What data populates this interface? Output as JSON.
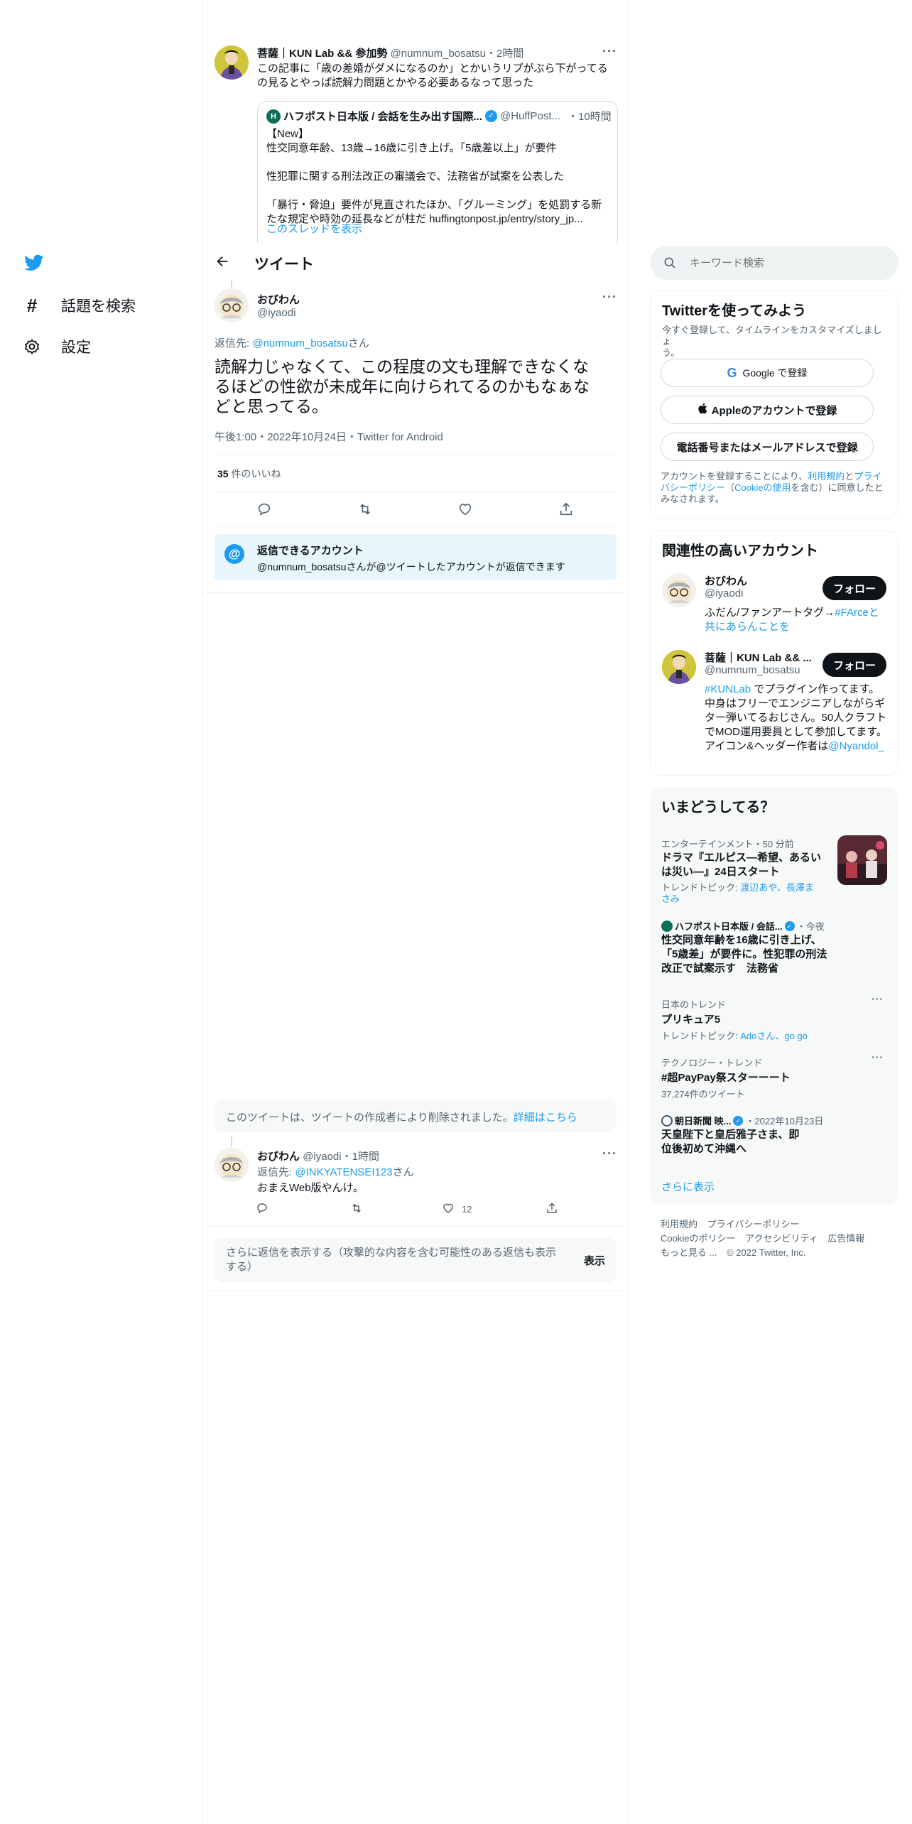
{
  "nav": {
    "explore_label": "話題を検索",
    "settings_label": "設定"
  },
  "header": {
    "title": "ツイート"
  },
  "parent_tweet": {
    "display_name": "菩薩｜KUN Lab && 参加勢",
    "handle": "@numnum_bosatsu",
    "time": "・2時間",
    "text_line1": "この記事に「歳の差婚がダメになるのか」とかいうリプがぶら下がってる",
    "text_line2": "の見るとやっぱ読解力問題とかやる必要あるなって思った",
    "quote": {
      "name": "ハフポスト日本版 / 会話を生み出す国際...",
      "handle": "@HuffPost...",
      "time": "・10時間",
      "line1": "【New】",
      "line2": "性交同意年齢、13歳→16歳に引き上げ。「5歳差以上」が要件",
      "line3": "性犯罪に関する刑法改正の審議会で、法務省が試案を公表した",
      "line4": "「暴行・脅迫」要件が見直されたほか、「グルーミング」を処罰する新",
      "line5": "たな規定や時効の延長などが柱だ huffingtonpost.jp/entry/story_jp..."
    },
    "show_thread": "このスレッドを表示"
  },
  "main_tweet": {
    "display_name": "おびわん",
    "handle": "@iyaodi",
    "reply_prefix": "返信先: ",
    "reply_to": "@numnum_bosatsu",
    "reply_suffix": "さん",
    "text_line1": "読解力じゃなくて、この程度の文も理解できなくな",
    "text_line2": "るほどの性欲が未成年に向けられてるのかもなぁな",
    "text_line3": "どと思ってる。",
    "meta": "午後1:00・2022年10月24日・Twitter for Android",
    "likes_count": "35",
    "likes_label": "件のいいね"
  },
  "reply_restriction": {
    "title": "返信できるアカウント",
    "text": "@numnum_bosatsuさんが@ツイートしたアカウントが返信できます"
  },
  "deleted_notice": {
    "text": "このツイートは、ツイートの作成者により削除されました。",
    "link": "詳細はこちら"
  },
  "reply_tweet": {
    "display_name": "おびわん",
    "handle": "@iyaodi",
    "time": "・1時間",
    "reply_prefix": "返信先: ",
    "reply_to": "@INKYATENSEI123",
    "reply_suffix": "さん",
    "text": "おまえWeb版やんけ。",
    "likes": "12"
  },
  "more_replies": {
    "text_line1": "さらに返信を表示する（攻撃的な内容を含む可能性のある返信も表示",
    "text_line2": "する）",
    "button": "表示"
  },
  "search": {
    "placeholder": "キーワード検索"
  },
  "signup": {
    "title": "Twitterを使ってみよう",
    "subtitle_line1": "今すぐ登録して、タイムラインをカスタマイズしましょ",
    "subtitle_line2": "う。",
    "google_button": "Google で登録",
    "apple_button": "Appleのアカウントで登録",
    "phone_button": "電話番号またはメールアドレスで登録",
    "legal_a": "アカウントを登録することにより、",
    "legal_terms": "利用規約",
    "legal_b": "と",
    "legal_privacy": "プライバシーポリシー",
    "legal_c": "（",
    "legal_cookie": "Cookieの使用",
    "legal_d": "を含む）に同意したとみなされます。"
  },
  "related": {
    "title": "関連性の高いアカウント",
    "follow_label": "フォロー",
    "accounts": [
      {
        "name": "おびわん",
        "handle": "@iyaodi",
        "bio_a": "ふだん/ファンアートタグ→",
        "bio_link": "#FArceと共にあらんことを"
      },
      {
        "name": "菩薩｜KUN Lab && ...",
        "handle": "@numnum_bosatsu",
        "bio_link1": "#KUNLab",
        "bio_b": " でプラグイン作ってます。中身はフリーでエンジニアしながらギター弾いてるおじさん。50人クラフトでMOD運用要員として参加してます。アイコン&ヘッダー作者は",
        "bio_link2": "@Nyandol_"
      }
    ]
  },
  "trends": {
    "title": "いまどうしてる？",
    "items": [
      {
        "meta": "エンターテインメント・50 分前",
        "title": "ドラマ『エルピス―希望、あるいは災い―』24日スタート",
        "topic_prefix": "トレンドトピック: ",
        "topic": "渡辺あや、長澤まさみ"
      },
      {
        "source": "ハフポスト日本版 / 会話...",
        "time": "・今夜",
        "title": "性交同意年齢を16歳に引き上げ、「5歳差」が要件に。性犯罪の刑法改正で試案示す　法務省"
      },
      {
        "meta": "日本のトレンド",
        "title": "プリキュア5",
        "topic_prefix": "トレンドトピック: ",
        "topic": "Adoさん、go go"
      },
      {
        "meta": "テクノロジー・トレンド",
        "title": "#超PayPay祭スターーート",
        "count": "37,274件のツイート"
      },
      {
        "source": "朝日新聞 映...",
        "time": "・2022年10月23日",
        "title": "天皇陛下と皇后雅子さま、即位後初めて沖縄へ"
      }
    ],
    "show_more": "さらに表示"
  },
  "footer": {
    "line1": [
      "利用規約",
      "プライバシーポリシー"
    ],
    "line2": [
      "Cookieのポリシー",
      "アクセシビリティ",
      "広告情報"
    ],
    "more": "もっと見る ...",
    "copyright": "© 2022 Twitter, Inc."
  },
  "colors": {
    "accent": "#1d9bf0",
    "text": "#0f1419",
    "muted": "#536471",
    "card_bg": "#f7f9f9",
    "border": "#eff3f4"
  }
}
